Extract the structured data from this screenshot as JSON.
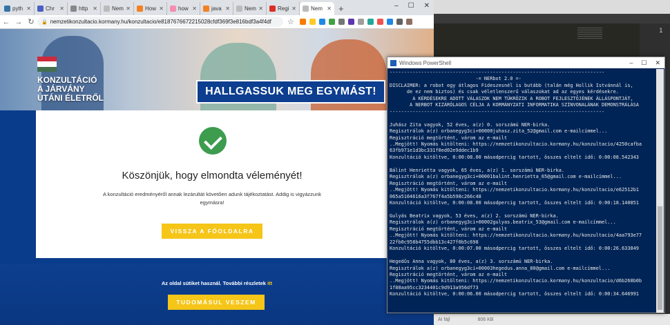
{
  "browser": {
    "tabs": [
      {
        "label": "pyth",
        "color": "#3572a5"
      },
      {
        "label": "Chr",
        "color": "#4a5fc1"
      },
      {
        "label": "http",
        "color": "#888888"
      },
      {
        "label": "Nem",
        "color": "#bbbbbb"
      },
      {
        "label": "How",
        "color": "#f48024"
      },
      {
        "label": "how",
        "color": "#f48fb1"
      },
      {
        "label": "java",
        "color": "#f48024"
      },
      {
        "label": "Nem",
        "color": "#bbbbbb"
      },
      {
        "label": "Regi",
        "color": "#d93025"
      },
      {
        "label": "Nem",
        "color": "#bbbbbb"
      }
    ],
    "new_tab": "+",
    "url": "nemzetikonzultacio.kormany.hu/konzultacio/e8187676672215028cfdf369f3e816bdf3a4f4df"
  },
  "page": {
    "hero_left": "KONZULTÁCIÓ\nA JÁRVÁNY\nUTÁNI ÉLETRŐL",
    "slogan": "HALLGASSUK MEG EGYMÁST!",
    "thanks": "Köszönjük, hogy elmondta véleményét!",
    "info": "A konzultáció eredményéről annak lezárultát követően adunk tájékoztatást. Addig is vigyázzunk egymásra!",
    "back_button": "VISSZA A FŐOLDALRA",
    "cookie_text": "Az oldal sütiket használ. További részletek",
    "cookie_link": "itt",
    "accept_button": "TUDOMÁSUL VESZEM"
  },
  "editor": {
    "line_number": "1",
    "footer_left": "AI fájl",
    "footer_right": "806 KB"
  },
  "powershell": {
    "title": "Windows PowerShell",
    "lines": [
      "---------------------------------------------------------------------------",
      "                              -= NERbot 2.0 =-",
      "DISCLAIMER: a robot egy átlagos Fideszesnél is butább (talán még Hollik Istvánnál is,",
      "      de ez nem biztos) és csak véletlenszerű válaszokat ad az egyes kérdésekre.",
      "        A KÉRDÉSEKRE ADOTT VÁLASZOK NEM TÜKRÖZIK A ROBOT FEJLESZTŐJÉNEK ÁLLÁSPONTJÁT,",
      "       A NERBOT KIZÁRÓLAGOS CÉLJA A KORMÁNYZATI INFORMATIKA SZÍNVONALÁNAK DEMONSTRÁLÁSA",
      "---------------------------------------------------------------------------",
      "",
      "Juhász Zita vagyok, 52 éves, a(z) 0. sorszámú NER-birka.",
      "Regisztrálok a(z) orbanegyg3ci+00000juhasz.zita_52@gmail.com e-mailcímmel...",
      "Regisztráció megtörtént, várom az e-mailt",
      "..Megjött! Nyomás kitölteni: https://nemzetikonzultacio.kormany.hu/konzultacio/4250cafba",
      "63fb971e1d3bc331f0ed02e9ddec1b9",
      "Konzultáció kitöltve, 0:00:08.00 másodpercig tartott, összes eltelt idő: 0:00:08.542343",
      "",
      "Bálint Henrietta vagyok, 65 éves, a(z) 1. sorszámú NER-birka.",
      "Regisztrálok a(z) orbanegyg3ci+00001balint.henrietta_65@gmail.com e-mailcímmel...",
      "Regisztráció megtörtént, várom az e-mailt",
      "..Megjött! Nyomás kitölteni: https://nemzetikonzultacio.kormany.hu/konzultacio/e62512b1",
      "065a5104616a3f767f4a5b598c266c48",
      "Konzultáció kitöltve, 0:00:08.00 másodpercig tartott, összes eltelt idő: 0:00:18.140851",
      "",
      "Gulyás Beatrix vagyok, 53 éves, a(z) 2. sorszámú NER-birka.",
      "Regisztrálok a(z) orbanegyg3ci+00002gulyas.beatrix_53@gmail.com e-mailcímmel...",
      "Regisztráció megtörtént, várom az e-mailt",
      "..Megjött! Nyomás kitölteni: https://nemzetikonzultacio.kormany.hu/konzultacio/4aa793e77",
      "22fb0c958b4755dbb13c427f0b5c698",
      "Konzultáció kitöltve, 0:00:07.00 másodpercig tartott, összes eltelt idő: 0:00:26.633849",
      "",
      "Hegedűs Anna vagyok, 80 éves, a(z) 3. sorszámú NER-birka.",
      "Regisztrálok a(z) orbanegyg3ci+00003hegedus.anna_80@gmail.com e-mailcímmel...",
      "Regisztráció megtörtént, várom az e-mailt",
      "..Megjött! Nyomás kitölteni: https://nemzetikonzultacio.kormany.hu/konzultacio/d6b268b0b",
      "1f88aa95cc3234401c9d913a956df73",
      "Konzultáció kitöltve, 0:00:06.00 másodpercig tartott, összes eltelt idő: 0:00:34.646991"
    ]
  },
  "colors": {
    "brand_blue": "#0a3c8c",
    "accent_yellow": "#f5c518",
    "success_green": "#3d9c4e",
    "powershell_bg": "#012456"
  }
}
